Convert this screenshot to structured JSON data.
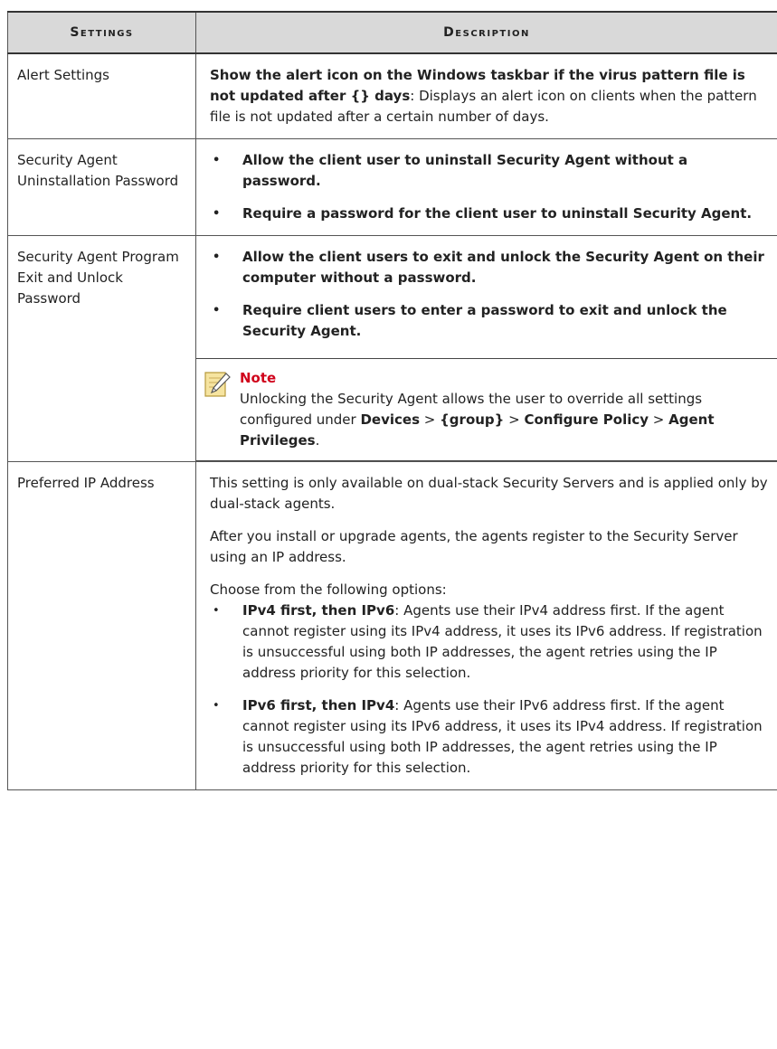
{
  "header": {
    "settings": "Settings",
    "description": "Description"
  },
  "rows": [
    {
      "setting": "Alert Settings",
      "bold": "Show the alert icon on the Windows taskbar if the virus pattern file is not updated after {} days",
      "text": ": Displays an alert icon on clients when the pattern file is not updated after a certain number of days."
    },
    {
      "setting": "Security Agent Uninstallation Password",
      "bullets": [
        "Allow the client user to uninstall Security Agent without a password.",
        "Require a password for the client user to uninstall Security Agent."
      ]
    },
    {
      "setting": "Security Agent Program Exit and Unlock Password",
      "bullets": [
        "Allow the client users to exit and unlock the Security Agent on their computer without a password.",
        "Require client users to enter a password to exit and unlock the Security Agent."
      ],
      "note": {
        "title": "Note",
        "text1": "Unlocking the Security Agent allows the user to override all settings configured under ",
        "devices": "Devices",
        "sep1": " > ",
        "group": "{group}",
        "sep2": " > ",
        "configure": "Configure Policy",
        "sep3": " > ",
        "privileges": "Agent Privileges",
        "end": "."
      }
    },
    {
      "setting": "Preferred IP Address",
      "paras": [
        "This setting is only available on dual-stack Security Servers and is applied only by dual-stack agents.",
        "After you install or upgrade agents, the agents register to the Security Server using an IP address.",
        "Choose from the following options:"
      ],
      "options": [
        {
          "bold": "IPv4 first, then IPv6",
          "text": ": Agents use their IPv4 address first. If the agent cannot register using its IPv4 address, it uses its IPv6 address. If registration is unsuccessful using both IP addresses, the agent retries using the IP address priority for this selection."
        },
        {
          "bold": "IPv6 first, then IPv4",
          "text": ": Agents use their IPv6 address first. If the agent cannot register using its IPv6 address, it uses its IPv4 address. If registration is unsuccessful using both IP addresses, the agent retries using the IP address priority for this selection."
        }
      ]
    }
  ]
}
